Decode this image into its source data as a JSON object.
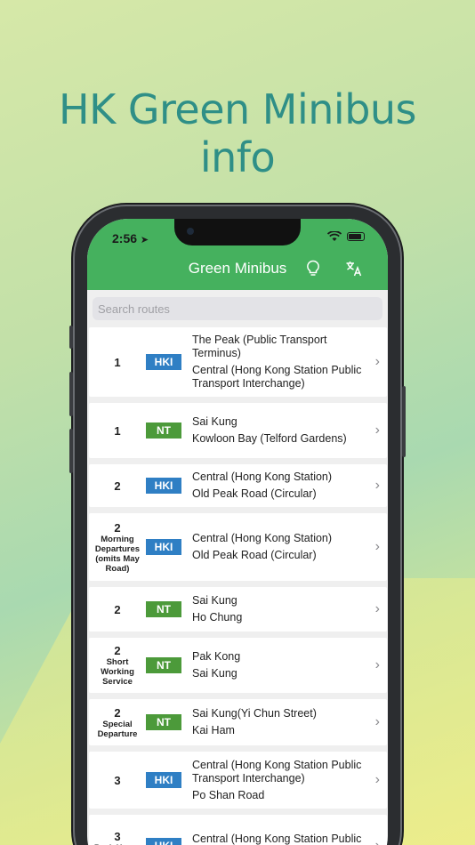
{
  "headline": {
    "line1": "HK Green Minibus",
    "line2": "info"
  },
  "status_bar": {
    "time": "2:56"
  },
  "nav": {
    "title": "Green Minibus",
    "hint_icon": "lightbulb-icon",
    "translate_icon": "translate-icon"
  },
  "search": {
    "placeholder": "Search routes",
    "value": ""
  },
  "colors": {
    "nav_green": "#45b15e",
    "hki_blue": "#2f7fc4",
    "nt_green": "#4c9a3a",
    "headline_teal": "#2f8f87"
  },
  "routes": [
    {
      "number": "1",
      "sub": "",
      "region": "HKI",
      "stop_a": "The Peak (Public Transport Terminus)",
      "stop_b": "Central (Hong Kong Station Public Transport Interchange)"
    },
    {
      "number": "1",
      "sub": "",
      "region": "NT",
      "stop_a": "Sai Kung",
      "stop_b": "Kowloon Bay (Telford Gardens)"
    },
    {
      "number": "2",
      "sub": "",
      "region": "HKI",
      "stop_a": "Central (Hong Kong Station)",
      "stop_b": "Old Peak Road (Circular)"
    },
    {
      "number": "2",
      "sub": "Morning Departures (omits May Road)",
      "region": "HKI",
      "stop_a": "Central (Hong Kong Station)",
      "stop_b": "Old Peak Road (Circular)"
    },
    {
      "number": "2",
      "sub": "",
      "region": "NT",
      "stop_a": "Sai Kung",
      "stop_b": "Ho Chung"
    },
    {
      "number": "2",
      "sub": "Short Working Service",
      "region": "NT",
      "stop_a": "Pak Kong",
      "stop_b": "Sai Kung"
    },
    {
      "number": "2",
      "sub": "Special Departure",
      "region": "NT",
      "stop_a": "Sai Kung(Yi Chun Street)",
      "stop_b": " Kai Ham"
    },
    {
      "number": "3",
      "sub": "",
      "region": "HKI",
      "stop_a": "Central (Hong Kong Station Public Transport Interchange)",
      "stop_b": "Po Shan Road"
    },
    {
      "number": "3",
      "sub": "Peak Hours Departures",
      "region": "HKI",
      "stop_a": "Central (Hong Kong Station Public Transport Interchange)",
      "stop_b": ""
    }
  ]
}
